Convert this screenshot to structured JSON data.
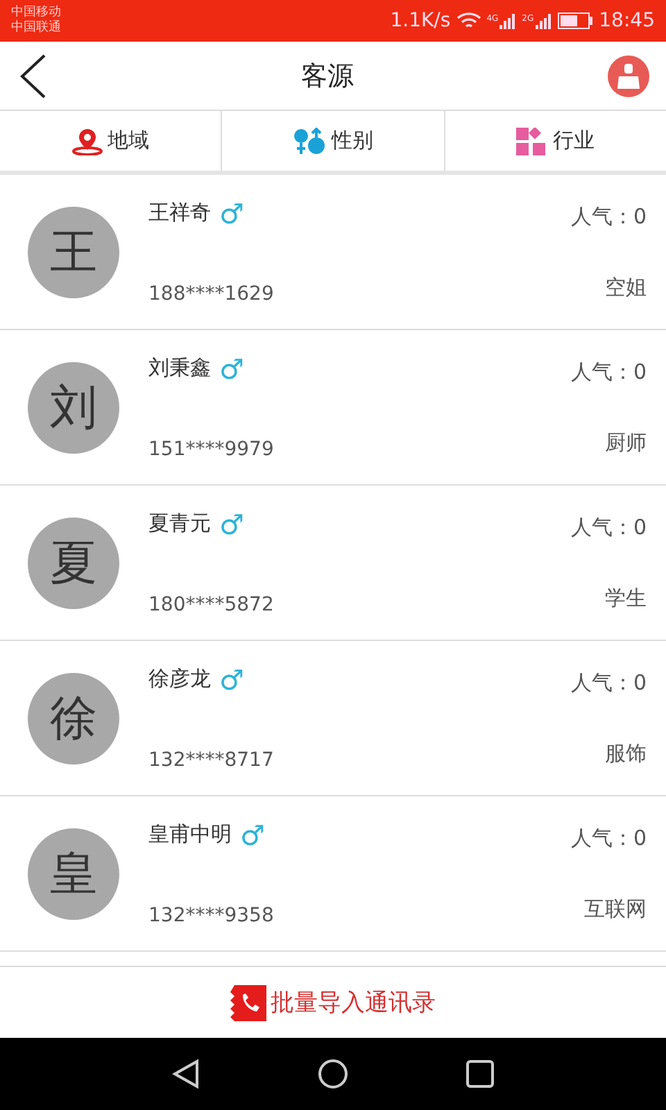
{
  "status_bar": {
    "carrier_1": "中国移动",
    "carrier_2": "中国联通",
    "speed": "1.1K/s",
    "signal_1": "4G",
    "signal_2": "2G",
    "time": "18:45"
  },
  "header": {
    "title": "客源"
  },
  "filters": [
    {
      "kind": "region",
      "label": "地域"
    },
    {
      "kind": "gender",
      "label": "性别"
    },
    {
      "kind": "industry",
      "label": "行业"
    }
  ],
  "contacts": [
    {
      "avatar": "王",
      "name": "王祥奇",
      "gender": "♂",
      "phone": "188****1629",
      "popularity": "人气：0",
      "job": "空姐"
    },
    {
      "avatar": "刘",
      "name": "刘秉鑫",
      "gender": "♂",
      "phone": "151****9979",
      "popularity": "人气：0",
      "job": "厨师"
    },
    {
      "avatar": "夏",
      "name": "夏青元",
      "gender": "♂",
      "phone": "180****5872",
      "popularity": "人气：0",
      "job": "学生"
    },
    {
      "avatar": "徐",
      "name": "徐彦龙",
      "gender": "♂",
      "phone": "132****8717",
      "popularity": "人气：0",
      "job": "服饰"
    },
    {
      "avatar": "皇",
      "name": "皇甫中明",
      "gender": "♂",
      "phone": "132****9358",
      "popularity": "人气：0",
      "job": "互联网"
    }
  ],
  "footer": {
    "button": "批量导入通讯录"
  }
}
